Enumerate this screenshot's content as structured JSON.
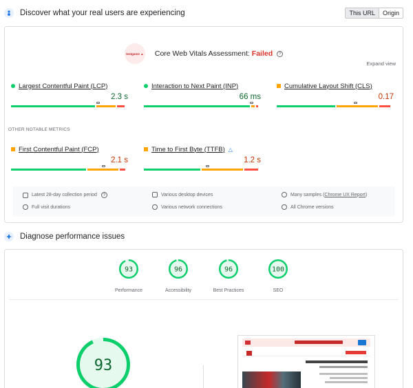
{
  "field_section": {
    "title": "Discover what your real users are experiencing",
    "toggle": [
      "This URL",
      "Origin"
    ]
  },
  "assessment": {
    "logo_text": "testgame ▲",
    "label": "Core Web Vitals Assessment:",
    "status": "Failed",
    "expand": "Expand view"
  },
  "core_metrics": [
    {
      "label": "Largest Contentful Paint (LCP)",
      "value": "2.3 s",
      "status": "good",
      "marker": 0.75,
      "segments": [
        0.74,
        0.18,
        0.08
      ]
    },
    {
      "label": "Interaction to Next Paint (INP)",
      "value": "66 ms",
      "status": "good",
      "marker": 0.93,
      "segments": [
        0.93,
        0.04,
        0.03
      ]
    },
    {
      "label": "Cumulative Layout Shift (CLS)",
      "value": "0.17",
      "status": "needs-improvement",
      "marker": 0.68,
      "segments": [
        0.52,
        0.37,
        0.11
      ]
    }
  ],
  "notable_heading": "OTHER NOTABLE METRICS",
  "notable_metrics": [
    {
      "label": "First Contentful Paint (FCP)",
      "value": "2.1 s",
      "status": "needs-improvement",
      "marker": 0.8,
      "segments": [
        0.66,
        0.28,
        0.06
      ]
    },
    {
      "label": "Time to First Byte (TTFB)",
      "value": "1.2 s",
      "status": "needs-improvement",
      "marker": 0.55,
      "segments": [
        0.5,
        0.37,
        0.13
      ]
    }
  ],
  "footer": {
    "period": "Latest 28-day collection period",
    "devices": "Various desktop devices",
    "samples_prefix": "Many samples (",
    "samples_link": "Chrome UX Report",
    "samples_suffix": ")",
    "visits": "Full visit durations",
    "network": "Various network connections",
    "chrome": "All Chrome versions"
  },
  "diagnose_section": {
    "title": "Diagnose performance issues"
  },
  "scores": [
    {
      "label": "Performance",
      "value": "93",
      "fraction": 0.93
    },
    {
      "label": "Accessibility",
      "value": "96",
      "fraction": 0.96
    },
    {
      "label": "Best Practices",
      "value": "96",
      "fraction": 0.96
    },
    {
      "label": "SEO",
      "value": "100",
      "fraction": 1.0
    }
  ],
  "big_score": {
    "value": "93",
    "fraction": 0.93
  },
  "colors": {
    "good": "#0cce6b",
    "good_text": "#0d652d",
    "average": "#ffa400",
    "average_text": "#c33300",
    "poor": "#ff4e42",
    "ring_bg": "#e6f9ef"
  }
}
